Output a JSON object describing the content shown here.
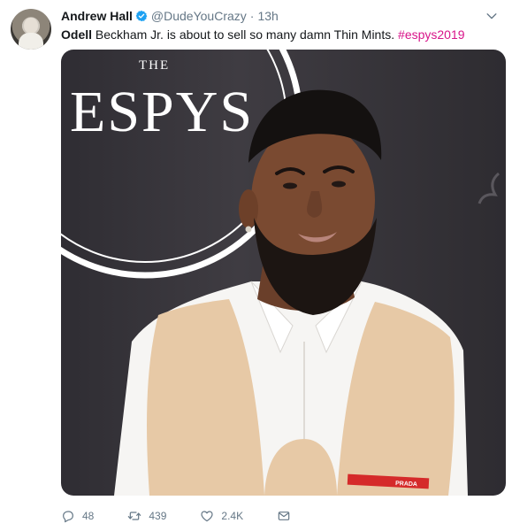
{
  "tweet": {
    "author": {
      "display_name": "Andrew Hall",
      "handle": "@DudeYouCrazy",
      "verified": true
    },
    "meta": {
      "separator": "·",
      "time_ago": "13h"
    },
    "text": {
      "bold_prefix": "Odell",
      "body": " Beckham Jr. is about to sell so many damn Thin Mints. ",
      "hashtag": "#espys2019"
    },
    "media": {
      "sign_top": "THE",
      "sign_main": "ESPYS",
      "tag_text": "PRADA",
      "colors": {
        "background": "#2f2d33",
        "vest": "#e7c9a6",
        "shirt": "#f6f5f3",
        "prada_red": "#d52a2a"
      }
    },
    "actions": {
      "replies": "48",
      "retweets": "439",
      "likes": "2.4K"
    },
    "colors": {
      "hashtag": "#d8148a",
      "muted": "#657786",
      "verified": "#1da1f2"
    }
  }
}
